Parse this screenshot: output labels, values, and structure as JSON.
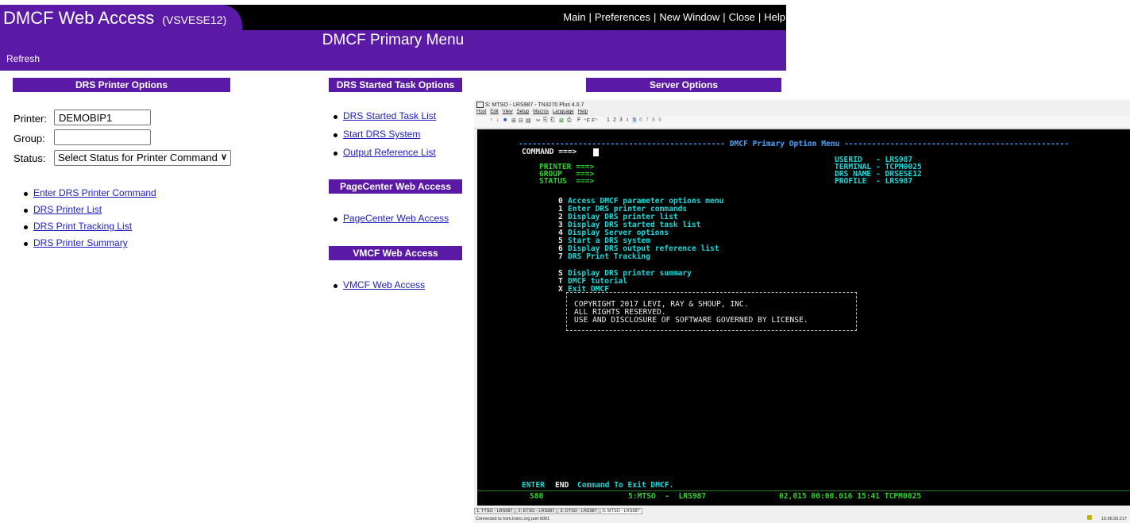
{
  "header": {
    "app_title": "DMCF Web Access",
    "host": "(VSVESE12)",
    "links": [
      "Main",
      "Preferences",
      "New Window",
      "Close",
      "Help"
    ],
    "menu_title": "DMCF Primary Menu",
    "refresh": "Refresh"
  },
  "printer_options": {
    "title": "DRS Printer Options",
    "printer_label": "Printer:",
    "printer_value": "DEMOBIP1",
    "group_label": "Group:",
    "group_value": "",
    "status_label": "Status:",
    "status_selected": "Select Status for Printer Command",
    "links": [
      "Enter DRS Printer Command",
      "DRS Printer List",
      "DRS Print Tracking List",
      "DRS Printer Summary"
    ]
  },
  "started_task": {
    "title": "DRS Started Task Options",
    "links": [
      "DRS Started Task List",
      "Start DRS System",
      "Output Reference List"
    ]
  },
  "pagecenter": {
    "title": "PageCenter Web Access",
    "links": [
      "PageCenter Web Access"
    ]
  },
  "vmcf": {
    "title": "VMCF Web Access",
    "links": [
      "VMCF Web Access"
    ]
  },
  "server_options": {
    "title": "Server Options"
  },
  "terminal": {
    "window_title": "S: MTSO - LRS987 - TN3270 Plus 4.0.7",
    "menu": [
      "Host",
      "Edit",
      "View",
      "Setup",
      "Macros",
      "Language",
      "Help"
    ],
    "toolbar": [
      "↑",
      "↓",
      "■",
      "⊞",
      "⊟",
      "▤",
      "✂",
      "⎘",
      "⎗",
      "⊠",
      "⎙",
      "F",
      "⁺F",
      "F⁺",
      "1",
      "2",
      "3",
      "4",
      "5",
      "6",
      "7",
      "8",
      "9"
    ],
    "header_line": "--------------------------------------------- DMCF Primary Option Menu -------------------------------------------------",
    "command_label": "COMMAND ===>",
    "printer_label": "PRINTER ===>",
    "group_label": "GROUP   ===>",
    "status_label": "STATUS  ===>",
    "userid": "USERID   - LRS987",
    "terminal": "TERMINAL - TCPM0025",
    "drs_name": "DRS NAME - DRSESE12",
    "profile": "PROFILE  - LRS987",
    "options": [
      {
        "key": "0",
        "text": "Access DMCF parameter options menu"
      },
      {
        "key": "1",
        "text": "Enter DRS printer commands"
      },
      {
        "key": "2",
        "text": "Display DRS printer list"
      },
      {
        "key": "3",
        "text": "Display DRS started task list"
      },
      {
        "key": "4",
        "text": "Display Server options"
      },
      {
        "key": "5",
        "text": "Start a DRS system"
      },
      {
        "key": "6",
        "text": "Display DRS output reference list"
      },
      {
        "key": "7",
        "text": "DRS Print Tracking"
      },
      {
        "key": "S",
        "text": "Display DRS printer summary"
      },
      {
        "key": "T",
        "text": "DMCF tutorial"
      },
      {
        "key": "X",
        "text": "Exit DMCF"
      }
    ],
    "copyright": [
      "COPYRIGHT 2017 LEVI, RAY & SHOUP, INC.",
      "ALL RIGHTS RESERVED.",
      "USE AND DISCLOSURE OF SOFTWARE GOVERNED BY LICENSE."
    ],
    "footer_enter": "ENTER",
    "footer_end": "END",
    "footer_rest": "Command To Exit DMCF.",
    "oia_left": "S80",
    "oia_session": "5:MTSO  -  LRS987",
    "oia_right": "02,015 00:00.016 15:41 TCPM0025",
    "sessions": [
      "1: TTSO - LRS987",
      "2: ETSO - LRS987",
      "3: OTSO - LRS987",
      "5: MTSO - LRS987"
    ],
    "status": "Connected to lrsm.lrsinc.org port 6001",
    "ip": "10.96.50.217"
  }
}
